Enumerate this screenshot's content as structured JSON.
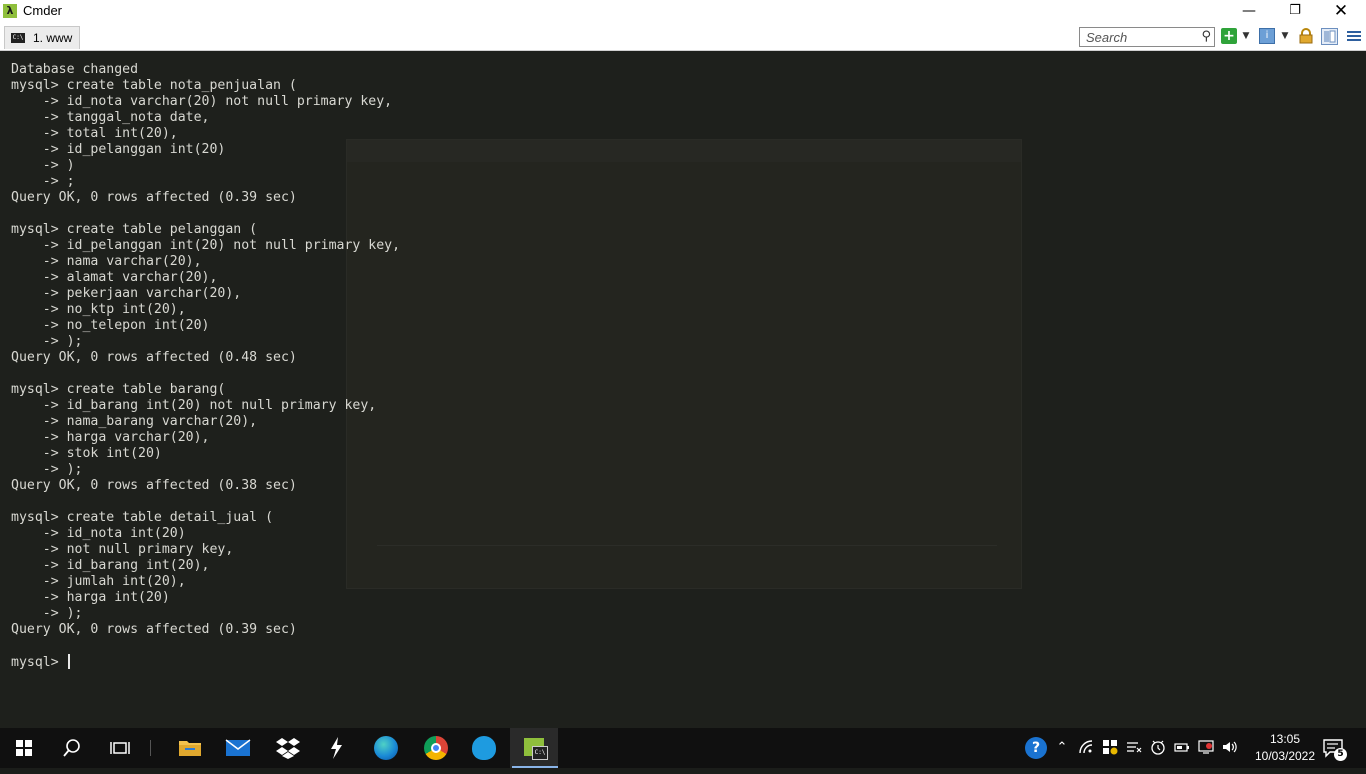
{
  "window": {
    "title": "Cmder",
    "app_icon_glyph": "λ"
  },
  "tabs": [
    {
      "label": "1. www",
      "icon": "console-icon"
    }
  ],
  "toolbar": {
    "search_placeholder": "Search",
    "icons": [
      "search-icon",
      "add-tab-icon",
      "dropdown-icon",
      "tab-menu-icon",
      "lock-icon",
      "view-icon",
      "hamburger-menu-icon"
    ]
  },
  "terminal": {
    "lines": [
      "Database changed",
      "mysql> create table nota_penjualan (",
      "    -> id_nota varchar(20) not null primary key,",
      "    -> tanggal_nota date,",
      "    -> total int(20),",
      "    -> id_pelanggan int(20)",
      "    -> )",
      "    -> ;",
      "Query OK, 0 rows affected (0.39 sec)",
      "",
      "mysql> create table pelanggan (",
      "    -> id_pelanggan int(20) not null primary key,",
      "    -> nama varchar(20),",
      "    -> alamat varchar(20),",
      "    -> pekerjaan varchar(20),",
      "    -> no_ktp int(20),",
      "    -> no_telepon int(20)",
      "    -> );",
      "Query OK, 0 rows affected (0.48 sec)",
      "",
      "mysql> create table barang(",
      "    -> id_barang int(20) not null primary key,",
      "    -> nama_barang varchar(20),",
      "    -> harga varchar(20),",
      "    -> stok int(20)",
      "    -> );",
      "Query OK, 0 rows affected (0.38 sec)",
      "",
      "mysql> create table detail_jual (",
      "    -> id_nota int(20)",
      "    -> not null primary key,",
      "    -> id_barang int(20),",
      "    -> jumlah int(20),",
      "    -> harga int(20)",
      "    -> );",
      "Query OK, 0 rows affected (0.39 sec)",
      ""
    ],
    "prompt": "mysql> "
  },
  "taskbar": {
    "apps": [
      "start-icon",
      "search-icon",
      "task-view-icon",
      "file-explorer-icon",
      "mail-icon",
      "dropbox-icon",
      "bolt-icon",
      "edge-icon",
      "chrome-icon",
      "bluestacks-icon",
      "cmder-icon"
    ],
    "clock": {
      "time": "13:05",
      "date": "10/03/2022"
    },
    "notifications": "5"
  },
  "colors": {
    "terminal_bg": "#1e201c",
    "terminal_fg": "#d8d8d2",
    "taskbar_bg": "#101010",
    "accent": "#8fbf3c"
  }
}
